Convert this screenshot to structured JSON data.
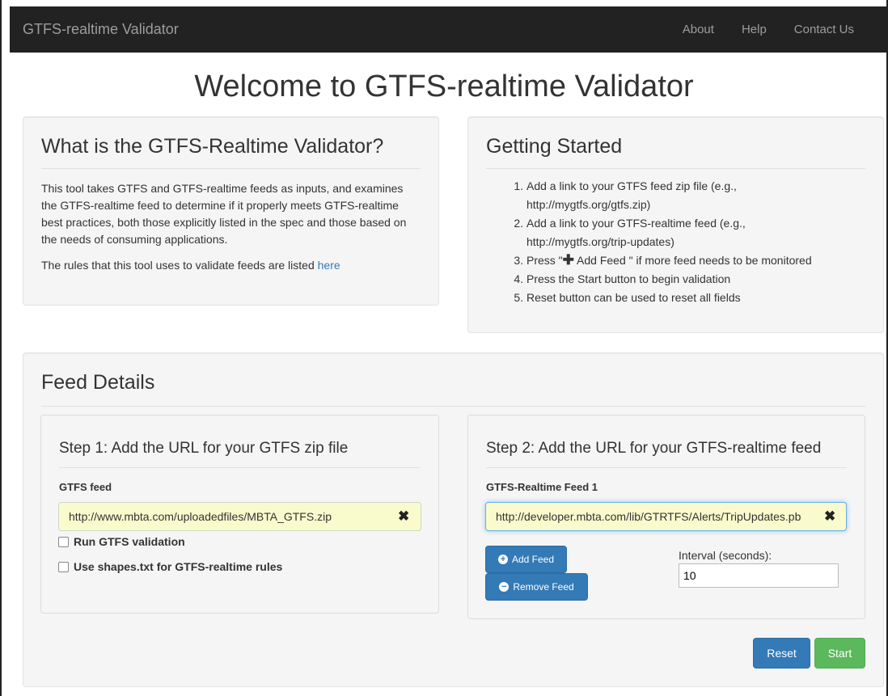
{
  "nav": {
    "brand": "GTFS-realtime Validator",
    "links": [
      "About",
      "Help",
      "Contact Us"
    ]
  },
  "page_title": "Welcome to GTFS-realtime Validator",
  "about": {
    "heading": "What is the GTFS-Realtime Validator?",
    "para1": "This tool takes GTFS and GTFS-realtime feeds as inputs, and examines the GTFS-realtime feed to determine if it properly meets GTFS-realtime best practices, both those explicitly listed in the spec and those based on the needs of consuming applications.",
    "para2_prefix": "The rules that this tool uses to validate feeds are listed ",
    "para2_link": "here"
  },
  "getting_started": {
    "heading": "Getting Started",
    "step1": "Add a link to your GTFS feed zip file (e.g.,",
    "step1_sub": "http://mygtfs.org/gtfs.zip)",
    "step2": "Add a link to your GTFS-realtime feed (e.g.,",
    "step2_sub": "http://mygtfs.org/trip-updates)",
    "step3_prefix": "Press \"",
    "step3_icon": "plus-icon",
    "step3_mid": " Add Feed \" if more feed needs to be monitored",
    "step4": "Press the Start button to begin validation",
    "step5": "Reset button can be used to reset all fields"
  },
  "feed_details": {
    "heading": "Feed Details",
    "step1": {
      "heading": "Step 1: Add the URL for your GTFS zip file",
      "label": "GTFS feed",
      "value": "http://www.mbta.com/uploadedfiles/MBTA_GTFS.zip",
      "check1": "Run GTFS validation",
      "check2": "Use shapes.txt for GTFS-realtime rules"
    },
    "step2": {
      "heading": "Step 2: Add the URL for your GTFS-realtime feed",
      "label": "GTFS-Realtime Feed 1",
      "value": "http://developer.mbta.com/lib/GTRTFS/Alerts/TripUpdates.pb",
      "add_button": "Add Feed",
      "remove_button": "Remove Feed",
      "interval_label": "Interval (seconds):",
      "interval_value": "10"
    },
    "reset_button": "Reset",
    "start_button": "Start"
  },
  "colors": {
    "navbar": "#222222",
    "primary": "#337ab7",
    "success": "#5cb85c",
    "input_autofill": "#fafbcd"
  }
}
